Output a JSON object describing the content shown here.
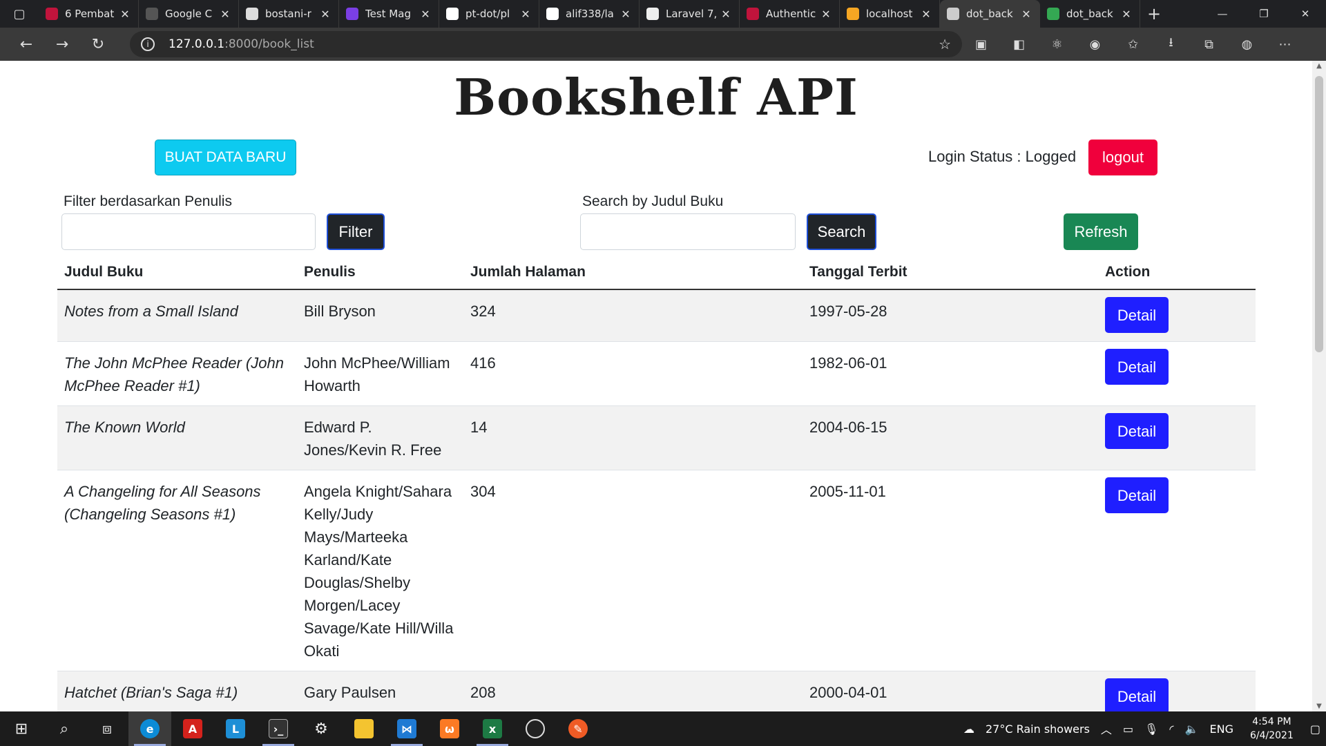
{
  "browser": {
    "tabs": [
      {
        "label": "6 Pembat",
        "color": "#c0143c"
      },
      {
        "label": "Google C",
        "color": "#555555"
      },
      {
        "label": "bostani-r",
        "color": "#dddddd"
      },
      {
        "label": "Test Mag",
        "color": "#7b3fe4"
      },
      {
        "label": "pt-dot/pl",
        "color": "#ffffff"
      },
      {
        "label": "alif338/la",
        "color": "#ffffff"
      },
      {
        "label": "Laravel 7,",
        "color": "#eeeeee"
      },
      {
        "label": "Authentic",
        "color": "#c0143c"
      },
      {
        "label": "localhost",
        "color": "#f5a623"
      },
      {
        "label": "dot_back",
        "color": "#cccccc"
      },
      {
        "label": "dot_back",
        "color": "#34a853"
      }
    ],
    "url_host": "127.0.0.1",
    "url_path": ":8000/book_list"
  },
  "page": {
    "title": "Bookshelf API",
    "create_button": "BUAT DATA BARU",
    "login_status": "Login Status : Logged",
    "logout_button": "logout",
    "filter_label": "Filter berdasarkan Penulis",
    "filter_button": "Filter",
    "search_label": "Search by Judul Buku",
    "search_button": "Search",
    "refresh_button": "Refresh"
  },
  "table": {
    "headers": [
      "Judul Buku",
      "Penulis",
      "Jumlah Halaman",
      "Tanggal Terbit",
      "Action"
    ],
    "rows": [
      {
        "judul": "Notes from a Small Island",
        "penulis": "Bill Bryson",
        "halaman": "324",
        "tanggal": "1997-05-28",
        "action": "Detail"
      },
      {
        "judul": "The John McPhee Reader (John McPhee Reader #1)",
        "penulis": "John McPhee/William Howarth",
        "halaman": "416",
        "tanggal": "1982-06-01",
        "action": "Detail"
      },
      {
        "judul": "The Known World",
        "penulis": "Edward P. Jones/Kevin R. Free",
        "halaman": "14",
        "tanggal": "2004-06-15",
        "action": "Detail"
      },
      {
        "judul": "A Changeling for All Seasons (Changeling Seasons #1)",
        "penulis": "Angela Knight/Sahara Kelly/Judy Mays/Marteeka Karland/Kate Douglas/Shelby Morgen/Lacey Savage/Kate Hill/Willa Okati",
        "halaman": "304",
        "tanggal": "2005-11-01",
        "action": "Detail"
      },
      {
        "judul": "Hatchet (Brian's Saga #1)",
        "penulis": "Gary Paulsen",
        "halaman": "208",
        "tanggal": "2000-04-01",
        "action": "Detail"
      }
    ]
  },
  "taskbar": {
    "weather": "27°C  Rain showers",
    "language": "ENG",
    "time": "4:54 PM",
    "date": "6/4/2021"
  }
}
